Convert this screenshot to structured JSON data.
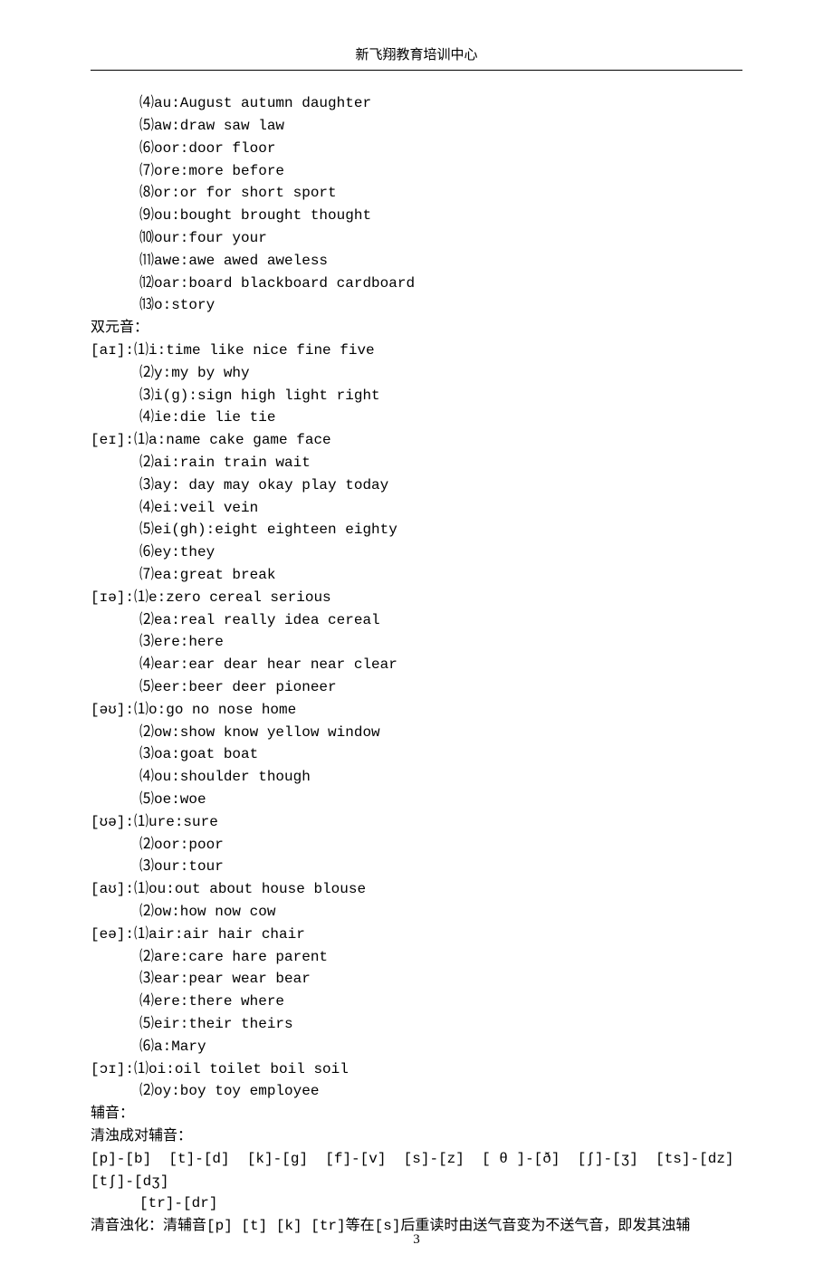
{
  "header": "新飞翔教育培训中心",
  "pageNumber": "3",
  "lines": [
    {
      "cls": "indent1",
      "text": "⑷au:August autumn daughter"
    },
    {
      "cls": "indent1",
      "text": "⑸aw:draw saw law"
    },
    {
      "cls": "indent1",
      "text": "⑹oor:door floor"
    },
    {
      "cls": "indent1",
      "text": "⑺ore:more before"
    },
    {
      "cls": "indent1",
      "text": "⑻or:or for short sport"
    },
    {
      "cls": "indent1",
      "text": "⑼ou:bought brought thought"
    },
    {
      "cls": "indent1",
      "text": "⑽our:four your"
    },
    {
      "cls": "indent1",
      "text": "⑾awe:awe awed aweless"
    },
    {
      "cls": "indent1",
      "text": "⑿oar:board blackboard cardboard"
    },
    {
      "cls": "indent1",
      "text": "⒀o:story"
    },
    {
      "cls": "indent0",
      "text": "双元音："
    },
    {
      "cls": "indent0",
      "text": "[aɪ]:⑴i:time like nice fine five"
    },
    {
      "cls": "indent1",
      "text": "⑵y:my by why"
    },
    {
      "cls": "indent1",
      "text": "⑶i(g):sign high light right"
    },
    {
      "cls": "indent1",
      "text": "⑷ie:die lie tie"
    },
    {
      "cls": "indent0",
      "text": "[eɪ]:⑴a:name cake game face"
    },
    {
      "cls": "indent1",
      "text": "⑵ai:rain train wait"
    },
    {
      "cls": "indent1",
      "text": "⑶ay: day may okay play today"
    },
    {
      "cls": "indent1",
      "text": "⑷ei:veil vein"
    },
    {
      "cls": "indent1",
      "text": "⑸ei(gh):eight eighteen eighty"
    },
    {
      "cls": "indent1",
      "text": "⑹ey:they"
    },
    {
      "cls": "indent1",
      "text": "⑺ea:great break"
    },
    {
      "cls": "indent0",
      "text": "[ɪə]:⑴e:zero cereal serious"
    },
    {
      "cls": "indent1",
      "text": "⑵ea:real really idea cereal"
    },
    {
      "cls": "indent1",
      "text": "⑶ere:here"
    },
    {
      "cls": "indent1",
      "text": "⑷ear:ear dear hear near clear"
    },
    {
      "cls": "indent1",
      "text": "⑸eer:beer deer pioneer"
    },
    {
      "cls": "indent0",
      "text": "[əʊ]:⑴o:go no nose home"
    },
    {
      "cls": "indent1",
      "text": "⑵ow:show know yellow window"
    },
    {
      "cls": "indent1",
      "text": "⑶oa:goat boat"
    },
    {
      "cls": "indent1",
      "text": "⑷ou:shoulder though"
    },
    {
      "cls": "indent1",
      "text": "⑸oe:woe"
    },
    {
      "cls": "indent0",
      "text": "[ʊə]:⑴ure:sure"
    },
    {
      "cls": "indent1",
      "text": "⑵oor:poor"
    },
    {
      "cls": "indent1",
      "text": "⑶our:tour"
    },
    {
      "cls": "indent0",
      "text": "[aʊ]:⑴ou:out about house blouse"
    },
    {
      "cls": "indent1",
      "text": "⑵ow:how now cow"
    },
    {
      "cls": "indent0",
      "text": "[eə]:⑴air:air hair chair"
    },
    {
      "cls": "indent1",
      "text": "⑵are:care hare parent"
    },
    {
      "cls": "indent1",
      "text": "⑶ear:pear wear bear"
    },
    {
      "cls": "indent1",
      "text": "⑷ere:there where"
    },
    {
      "cls": "indent1",
      "text": "⑸eir:their theirs"
    },
    {
      "cls": "indent1",
      "text": "⑹a:Mary"
    },
    {
      "cls": "indent0",
      "text": "[ɔɪ]:⑴oi:oil toilet boil soil"
    },
    {
      "cls": "indent1",
      "text": "⑵oy:boy toy employee"
    },
    {
      "cls": "indent0",
      "text": "辅音："
    },
    {
      "cls": "indent0",
      "text": "清浊成对辅音："
    },
    {
      "cls": "indent0",
      "text": "[p]-[b]  [t]-[d]  [k]-[g]  [f]-[v]  [s]-[z]  [ θ ]-[ð]  [ʃ]-[ʒ]  [ts]-[dz]    [tʃ]-[dʒ]"
    },
    {
      "cls": "indent1",
      "text": "[tr]-[dr]"
    },
    {
      "cls": "indent0",
      "text": "清音浊化：清辅音[p] [t] [k] [tr]等在[s]后重读时由送气音变为不送气音，即发其浊辅"
    }
  ]
}
